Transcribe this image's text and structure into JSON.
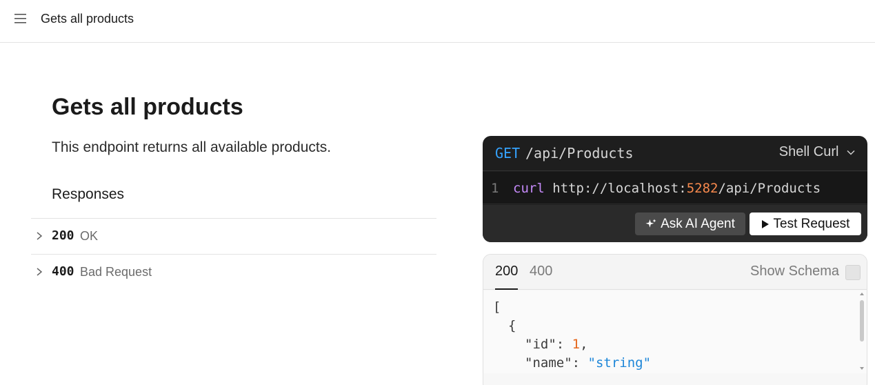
{
  "header": {
    "title": "Gets all products"
  },
  "page": {
    "title": "Gets all products",
    "description": "This endpoint returns all available products.",
    "responses_heading": "Responses",
    "responses": [
      {
        "code": "200",
        "label": "OK"
      },
      {
        "code": "400",
        "label": "Bad Request"
      }
    ]
  },
  "request": {
    "method": "GET",
    "path": "/api/Products",
    "language": "Shell Curl",
    "line_number": "1",
    "code": {
      "command": "curl",
      "url_prefix": "http://localhost:",
      "port": "5282",
      "url_suffix": "/api/Products"
    },
    "ask_ai_label": "Ask AI Agent",
    "test_request_label": "Test Request"
  },
  "response_example": {
    "tabs": [
      "200",
      "400"
    ],
    "active_tab": "200",
    "show_schema_label": "Show Schema",
    "json_lines": {
      "open_bracket": "[",
      "open_brace": "{",
      "id_key": "\"id\"",
      "id_value": "1",
      "name_key": "\"name\"",
      "name_value": "\"string\""
    }
  },
  "colors": {
    "method": "#35a3ff",
    "curl": "#c58af9",
    "port": "#f7894d",
    "json_number": "#e5651a",
    "json_string": "#1d86d8"
  }
}
